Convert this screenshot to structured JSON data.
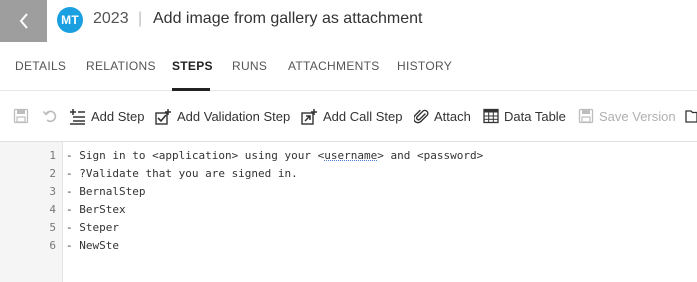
{
  "header": {
    "avatar_initials": "MT",
    "test_id": "2023",
    "separator": "|",
    "title": "Add image from gallery as attachment"
  },
  "tabs": [
    {
      "label": "DETAILS",
      "active": false
    },
    {
      "label": "RELATIONS",
      "active": false
    },
    {
      "label": "STEPS",
      "active": true
    },
    {
      "label": "RUNS",
      "active": false
    },
    {
      "label": "ATTACHMENTS",
      "active": false
    },
    {
      "label": "HISTORY",
      "active": false
    }
  ],
  "toolbar": {
    "save_icon": "save-icon",
    "undo_icon": "undo-icon",
    "add_step": "Add Step",
    "add_validation_step": "Add Validation Step",
    "add_call_step": "Add Call Step",
    "attach": "Attach",
    "data_table": "Data Table",
    "save_version": "Save Version"
  },
  "editor": {
    "line_numbers": [
      "1",
      "2",
      "3",
      "4",
      "5",
      "6"
    ],
    "line1_prefix": "- Sign in to <application> using your <",
    "line1_underlined": "username",
    "line1_suffix": "> and <password>",
    "lines": [
      "- ?Validate that you are signed in.",
      "- BernalStep",
      "- BerStex",
      "- Steper",
      "- NewSte"
    ]
  },
  "colors": {
    "accent_avatar": "#1a9fe0",
    "back_button": "#9e9e9e",
    "active_tab": "#222222"
  }
}
